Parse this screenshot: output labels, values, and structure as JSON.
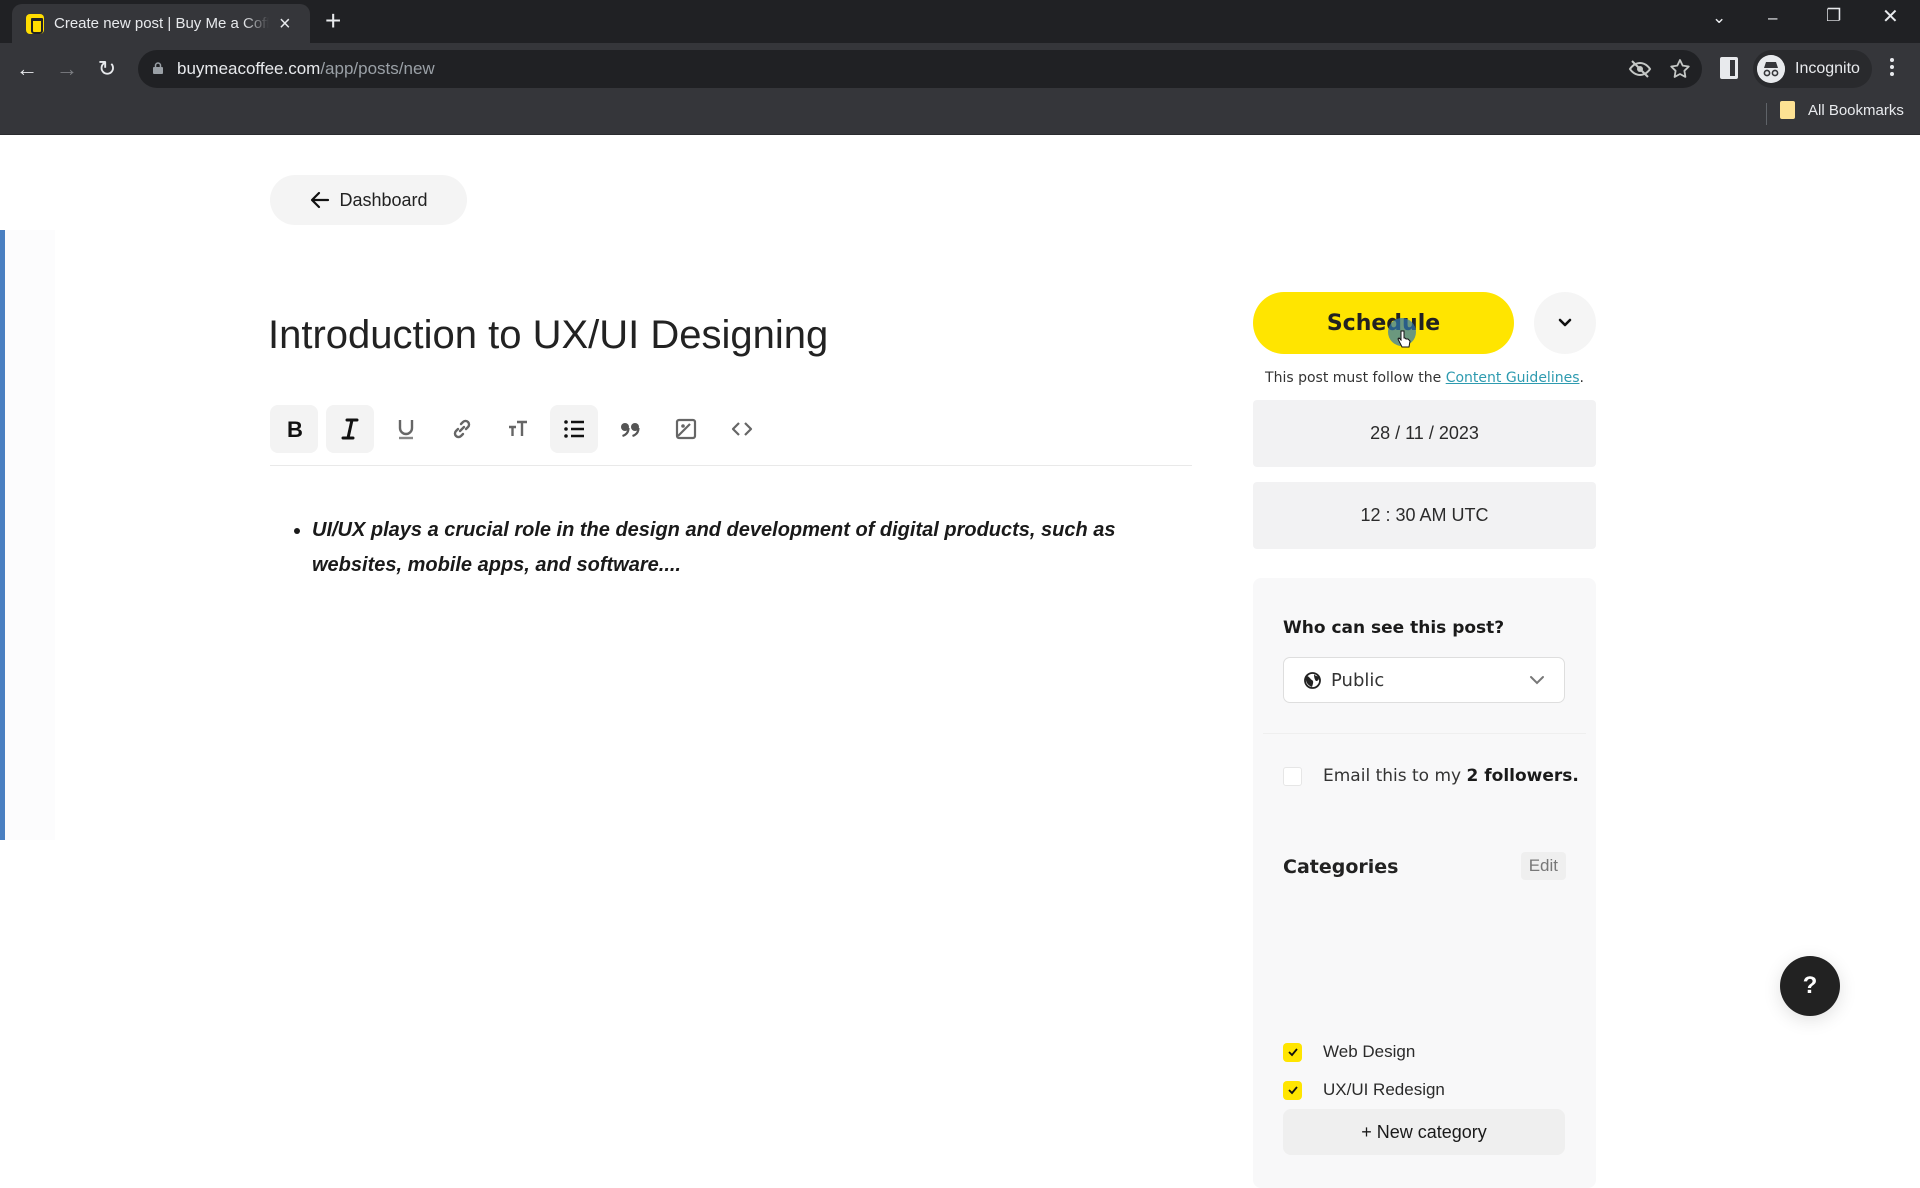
{
  "browser": {
    "tab_title": "Create new post | Buy Me a Coffee",
    "url_domain": "buymeacoffee.com",
    "url_path": "/app/posts/new",
    "profile_label": "Incognito",
    "bookmarks_label": "All Bookmarks"
  },
  "page": {
    "back_label": "Dashboard",
    "post_title": "Introduction to UX/UI Designing",
    "toolbar": [
      {
        "name": "bold",
        "active": true
      },
      {
        "name": "italic",
        "active": true
      },
      {
        "name": "underline",
        "active": false
      },
      {
        "name": "link",
        "active": false
      },
      {
        "name": "text-size",
        "active": false
      },
      {
        "name": "bullet-list",
        "active": true
      },
      {
        "name": "quote",
        "active": false
      },
      {
        "name": "image",
        "active": false
      },
      {
        "name": "code",
        "active": false
      }
    ],
    "body_bullets": [
      "UI/UX plays a crucial role in the design and development of digital products, such as websites, mobile apps, and software...."
    ]
  },
  "sidebar": {
    "schedule_label": "Schedule",
    "guidelines_prefix": "This post must follow the ",
    "guidelines_link": "Content Guidelines",
    "guidelines_suffix": ".",
    "date": "28 / 11 / 2023",
    "time": "12 : 30 AM UTC",
    "visibility_heading": "Who can see this post?",
    "visibility_value": "Public",
    "email_prefix": "Email this to my ",
    "email_count": "2 followers.",
    "email_checked": false,
    "categories_heading": "Categories",
    "categories_edit": "Edit",
    "categories": [
      {
        "label": "Web Design",
        "checked": true
      },
      {
        "label": "UX/UI Redesign",
        "checked": true
      }
    ],
    "new_category_label": "+ New category"
  },
  "help_label": "?",
  "colors": {
    "accent_yellow": "#ffe500",
    "link_teal": "#2e9bb0",
    "chrome_dark": "#202124"
  }
}
